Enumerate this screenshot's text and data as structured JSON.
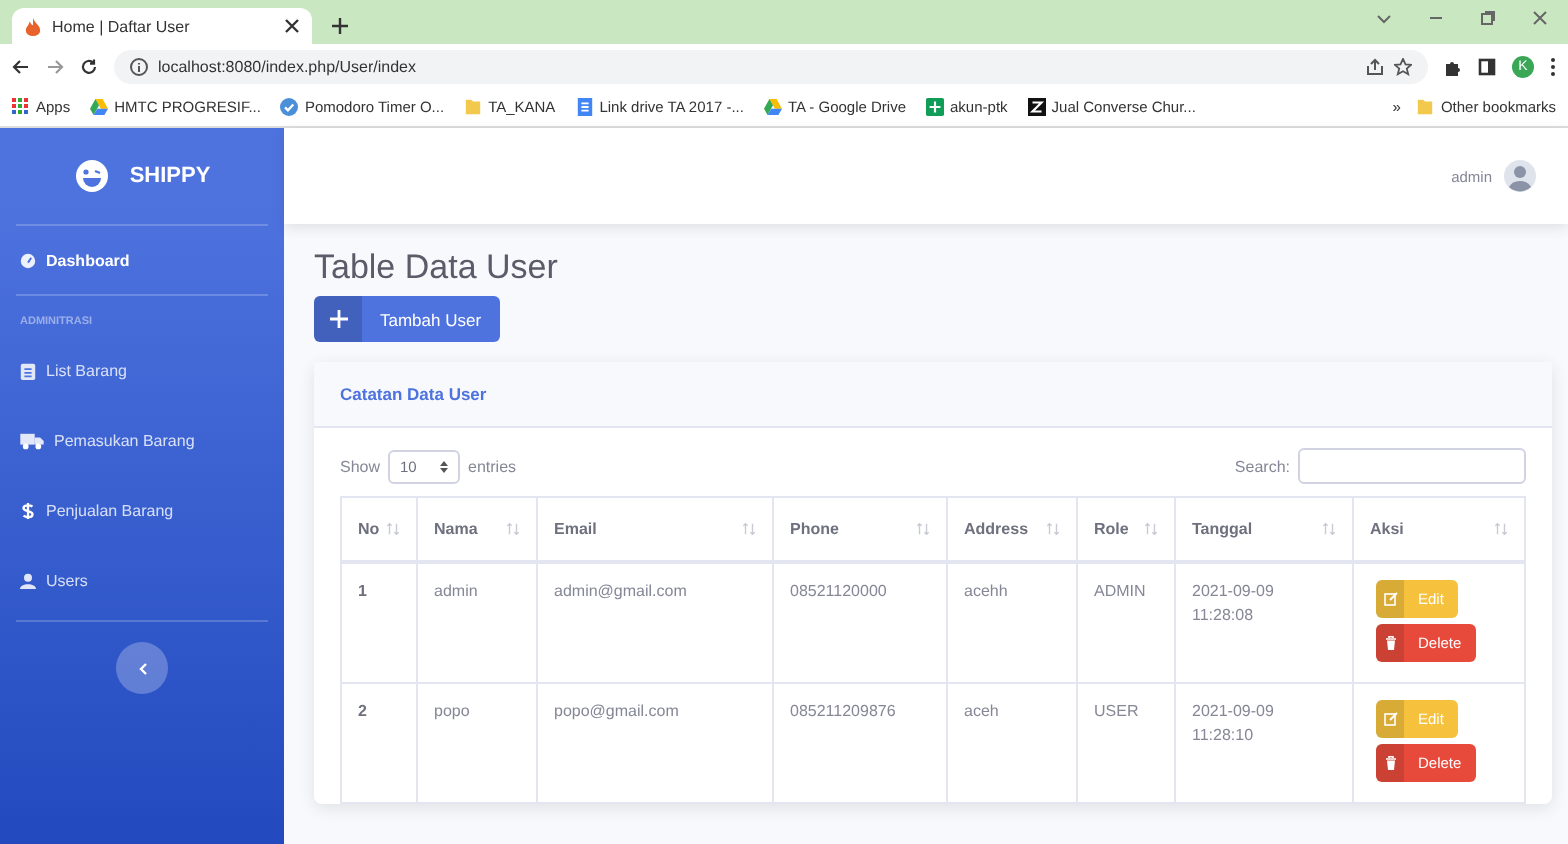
{
  "browser": {
    "tab_title": "Home | Daftar User",
    "url": "localhost:8080/index.php/User/index",
    "bookmarks": [
      {
        "label": "Apps",
        "kind": "apps"
      },
      {
        "label": "HMTC PROGRESIF...",
        "kind": "drive"
      },
      {
        "label": "Pomodoro Timer O...",
        "kind": "check"
      },
      {
        "label": "TA_KANA",
        "kind": "folder"
      },
      {
        "label": "Link drive TA 2017 -...",
        "kind": "doc"
      },
      {
        "label": "TA - Google Drive",
        "kind": "drive"
      },
      {
        "label": "akun-ptk",
        "kind": "sheet"
      },
      {
        "label": "Jual Converse Chur...",
        "kind": "z"
      }
    ],
    "more": "»",
    "other_bookmarks": "Other bookmarks",
    "profile_initial": "K"
  },
  "sidebar": {
    "brand": "SHIPPY",
    "items": [
      {
        "label": "Dashboard",
        "selected": true,
        "kind": "item"
      },
      {
        "label": "ADMINITRASI",
        "kind": "heading"
      },
      {
        "label": "List Barang",
        "selected": false,
        "kind": "item"
      },
      {
        "label": "Pemasukan Barang",
        "selected": false,
        "kind": "item"
      },
      {
        "label": "Penjualan Barang",
        "selected": false,
        "kind": "item"
      },
      {
        "label": "Users",
        "selected": false,
        "kind": "item"
      }
    ]
  },
  "topbar": {
    "user": "admin"
  },
  "page": {
    "title": "Table Data User",
    "add_button": "Tambah User"
  },
  "card": {
    "title": "Catatan Data User",
    "show_label": "Show",
    "page_size": "10",
    "entries_label": "entries",
    "search_label": "Search:"
  },
  "table": {
    "columns": [
      "No",
      "Nama",
      "Email",
      "Phone",
      "Address",
      "Role",
      "Tanggal",
      "Aksi"
    ],
    "rows": [
      {
        "cells": [
          "1",
          "admin",
          "admin@gmail.com",
          "08521120000",
          "acehh",
          "ADMIN",
          "2021-09-09 11:28:08"
        ],
        "actions": [
          {
            "kind": "edit",
            "label": "Edit"
          },
          {
            "kind": "delete",
            "label": "Delete"
          }
        ]
      },
      {
        "cells": [
          "2",
          "popo",
          "popo@gmail.com",
          "085211209876",
          "aceh",
          "USER",
          "2021-09-09 11:28:10"
        ],
        "actions": [
          {
            "kind": "edit",
            "label": "Edit"
          },
          {
            "kind": "delete",
            "label": "Delete"
          }
        ]
      }
    ]
  }
}
